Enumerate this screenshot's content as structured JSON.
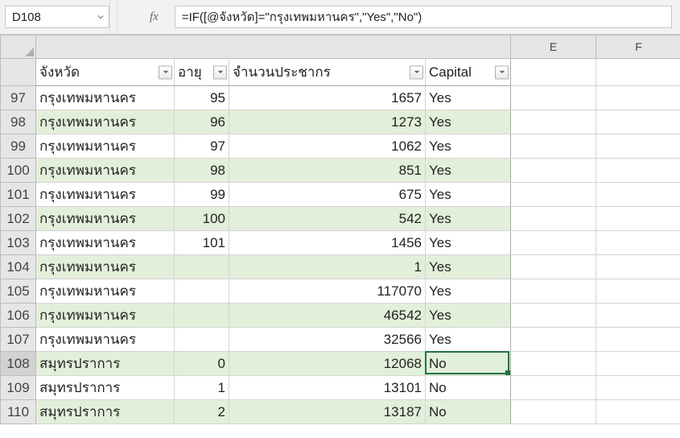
{
  "name_box": "D108",
  "formula": "=IF([@จังหวัด]=\"กรุงเทพมหานคร\",\"Yes\",\"No\")",
  "fx_label": "fx",
  "col_headers": {
    "e": "E",
    "f": "F"
  },
  "table_headers": {
    "a": "จังหวัด",
    "b": "อายุ",
    "c": "จำนวนประชากร",
    "d": "Capital"
  },
  "rows": [
    {
      "n": 97,
      "a": "กรุงเทพมหานคร",
      "b": "95",
      "c": "1657",
      "d": "Yes",
      "band": "odd"
    },
    {
      "n": 98,
      "a": "กรุงเทพมหานคร",
      "b": "96",
      "c": "1273",
      "d": "Yes",
      "band": "even"
    },
    {
      "n": 99,
      "a": "กรุงเทพมหานคร",
      "b": "97",
      "c": "1062",
      "d": "Yes",
      "band": "odd"
    },
    {
      "n": 100,
      "a": "กรุงเทพมหานคร",
      "b": "98",
      "c": "851",
      "d": "Yes",
      "band": "even"
    },
    {
      "n": 101,
      "a": "กรุงเทพมหานคร",
      "b": "99",
      "c": "675",
      "d": "Yes",
      "band": "odd"
    },
    {
      "n": 102,
      "a": "กรุงเทพมหานคร",
      "b": "100",
      "c": "542",
      "d": "Yes",
      "band": "even"
    },
    {
      "n": 103,
      "a": "กรุงเทพมหานคร",
      "b": "101",
      "c": "1456",
      "d": "Yes",
      "band": "odd"
    },
    {
      "n": 104,
      "a": "กรุงเทพมหานคร",
      "b": "",
      "c": "1",
      "d": "Yes",
      "band": "even"
    },
    {
      "n": 105,
      "a": "กรุงเทพมหานคร",
      "b": "",
      "c": "117070",
      "d": "Yes",
      "band": "odd"
    },
    {
      "n": 106,
      "a": "กรุงเทพมหานคร",
      "b": "",
      "c": "46542",
      "d": "Yes",
      "band": "even"
    },
    {
      "n": 107,
      "a": "กรุงเทพมหานคร",
      "b": "",
      "c": "32566",
      "d": "Yes",
      "band": "odd"
    },
    {
      "n": 108,
      "a": "สมุทรปราการ",
      "b": "0",
      "c": "12068",
      "d": "No",
      "band": "even",
      "selected": true
    },
    {
      "n": 109,
      "a": "สมุทรปราการ",
      "b": "1",
      "c": "13101",
      "d": "No",
      "band": "odd"
    },
    {
      "n": 110,
      "a": "สมุทรปราการ",
      "b": "2",
      "c": "13187",
      "d": "No",
      "band": "even"
    }
  ]
}
